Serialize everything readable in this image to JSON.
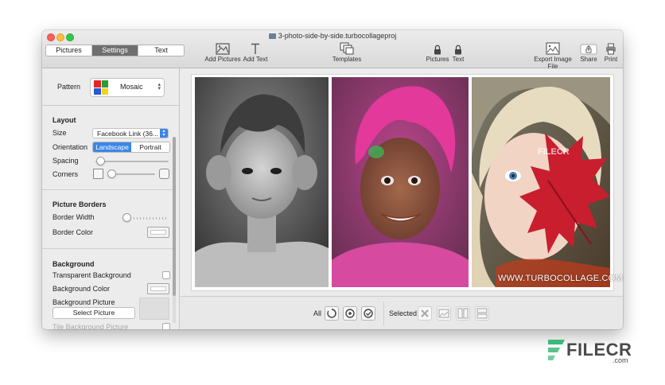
{
  "window": {
    "title": "3-photo-side-by-side.turbocollageproj"
  },
  "tabs": [
    {
      "label": "Pictures",
      "active": false
    },
    {
      "label": "Settings",
      "active": true
    },
    {
      "label": "Text",
      "active": false
    }
  ],
  "toolbar": {
    "add_pictures": "Add Pictures",
    "add_text": "Add Text",
    "templates": "Templates",
    "lock_pictures": "Pictures",
    "lock_text": "Text",
    "export": "Export Image File",
    "share": "Share",
    "print": "Print"
  },
  "sidebar": {
    "pattern_label": "Pattern",
    "pattern_value": "Mosaic",
    "layout_header": "Layout",
    "size_label": "Size",
    "size_value": "Facebook Link (36...",
    "orientation_label": "Orientation",
    "orientation_options": [
      "Landscape",
      "Portrait"
    ],
    "orientation_selected": "Landscape",
    "spacing_label": "Spacing",
    "spacing_level": 0.05,
    "corners_label": "Corners",
    "corners_level": 0.0,
    "borders_header": "Picture Borders",
    "border_width_label": "Border Width",
    "border_width_level": 0.0,
    "border_color_label": "Border Color",
    "background_header": "Background",
    "transparent_bg_label": "Transparent Background",
    "bg_color_label": "Background Color",
    "bg_picture_label": "Background Picture",
    "select_picture_button": "Select Picture",
    "tile_bg_label": "Tile Background Picture"
  },
  "canvas": {
    "watermark_text": "WWW.TURBOCOLLAGE.COM",
    "center_watermark": "FILECR"
  },
  "bottombar": {
    "all_label": "All",
    "selected_label": "Selected"
  },
  "brand": {
    "name": "FILECR",
    "domain": ".com"
  },
  "colors": {
    "accent": "#3b86e8",
    "active_tab": "#6f6f6f",
    "brand_green": "#3cb878"
  }
}
